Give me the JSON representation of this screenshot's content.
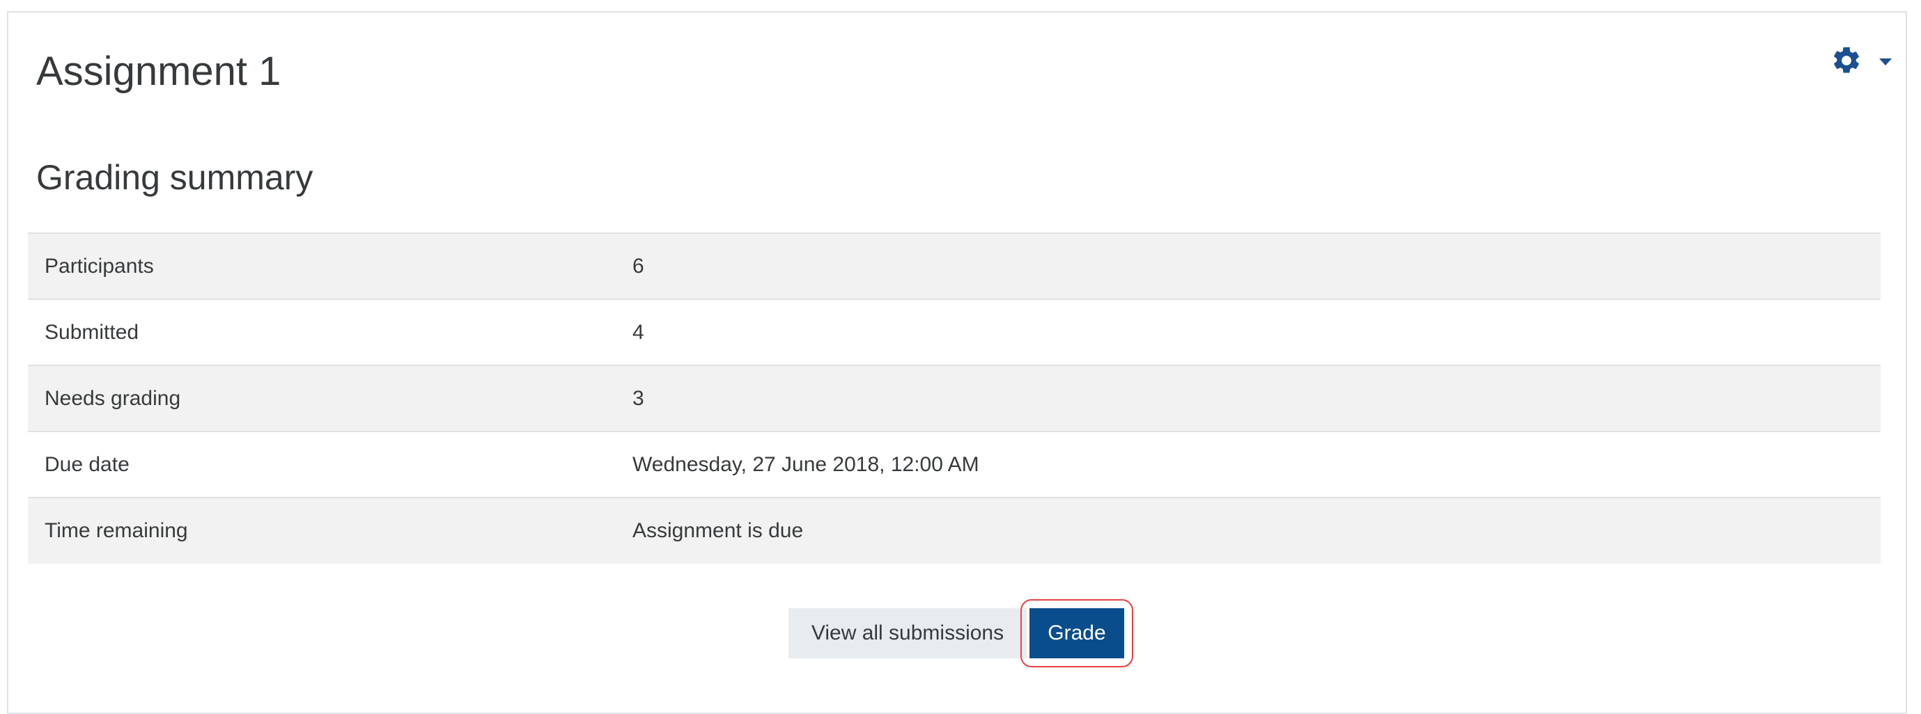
{
  "page": {
    "title": "Assignment 1",
    "section_title": "Grading summary"
  },
  "settings_menu": {
    "icon": "gear-icon",
    "caret_icon": "caret-down-icon"
  },
  "grading_summary": {
    "rows": [
      {
        "label": "Participants",
        "value": "6"
      },
      {
        "label": "Submitted",
        "value": "4"
      },
      {
        "label": "Needs grading",
        "value": "3"
      },
      {
        "label": "Due date",
        "value": "Wednesday, 27 June 2018, 12:00 AM"
      },
      {
        "label": "Time remaining",
        "value": "Assignment is due"
      }
    ]
  },
  "actions": {
    "view_all_label": "View all submissions",
    "grade_label": "Grade"
  },
  "colors": {
    "primary": "#0a4d8c",
    "highlight": "#e8423f",
    "row_shade": "#f2f2f2"
  }
}
